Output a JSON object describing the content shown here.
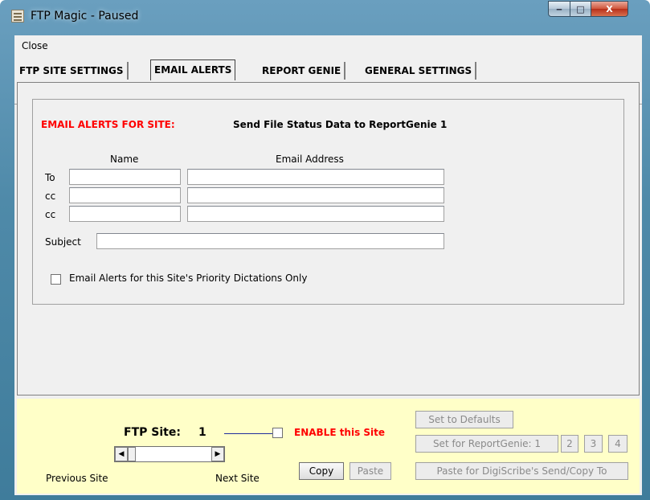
{
  "window": {
    "title": "FTP Magic - Paused",
    "min": "‒",
    "max": "□",
    "close": "X"
  },
  "menu": {
    "close": "Close"
  },
  "tabs": [
    {
      "label": "FTP SITE SETTINGS"
    },
    {
      "label": "EMAIL ALERTS"
    },
    {
      "label": "REPORT GENIE"
    },
    {
      "label": "GENERAL SETTINGS"
    }
  ],
  "email": {
    "heading": "EMAIL ALERTS FOR SITE:",
    "site_name": "Send File Status Data to ReportGenie 1",
    "col_name": "Name",
    "col_email": "Email Address",
    "to_label": "To",
    "cc1_label": "cc",
    "cc2_label": "cc",
    "subject_label": "Subject",
    "priority_label": "Email Alerts for this Site's Priority Dictations Only",
    "to_name": "",
    "to_email": "",
    "cc1_name": "",
    "cc1_email": "",
    "cc2_name": "",
    "cc2_email": "",
    "subject": ""
  },
  "bottom": {
    "ftp_site_label": "FTP Site:",
    "ftp_site_number": "1",
    "enable_label": "ENABLE this Site",
    "previous_site": "Previous Site",
    "next_site": "Next Site",
    "copy": "Copy",
    "paste": "Paste",
    "set_defaults": "Set to Defaults",
    "set_reportgenie": "Set for ReportGenie: 1",
    "rg2": "2",
    "rg3": "3",
    "rg4": "4",
    "paste_digiscribe": "Paste for DigiScribe's Send/Copy To"
  }
}
